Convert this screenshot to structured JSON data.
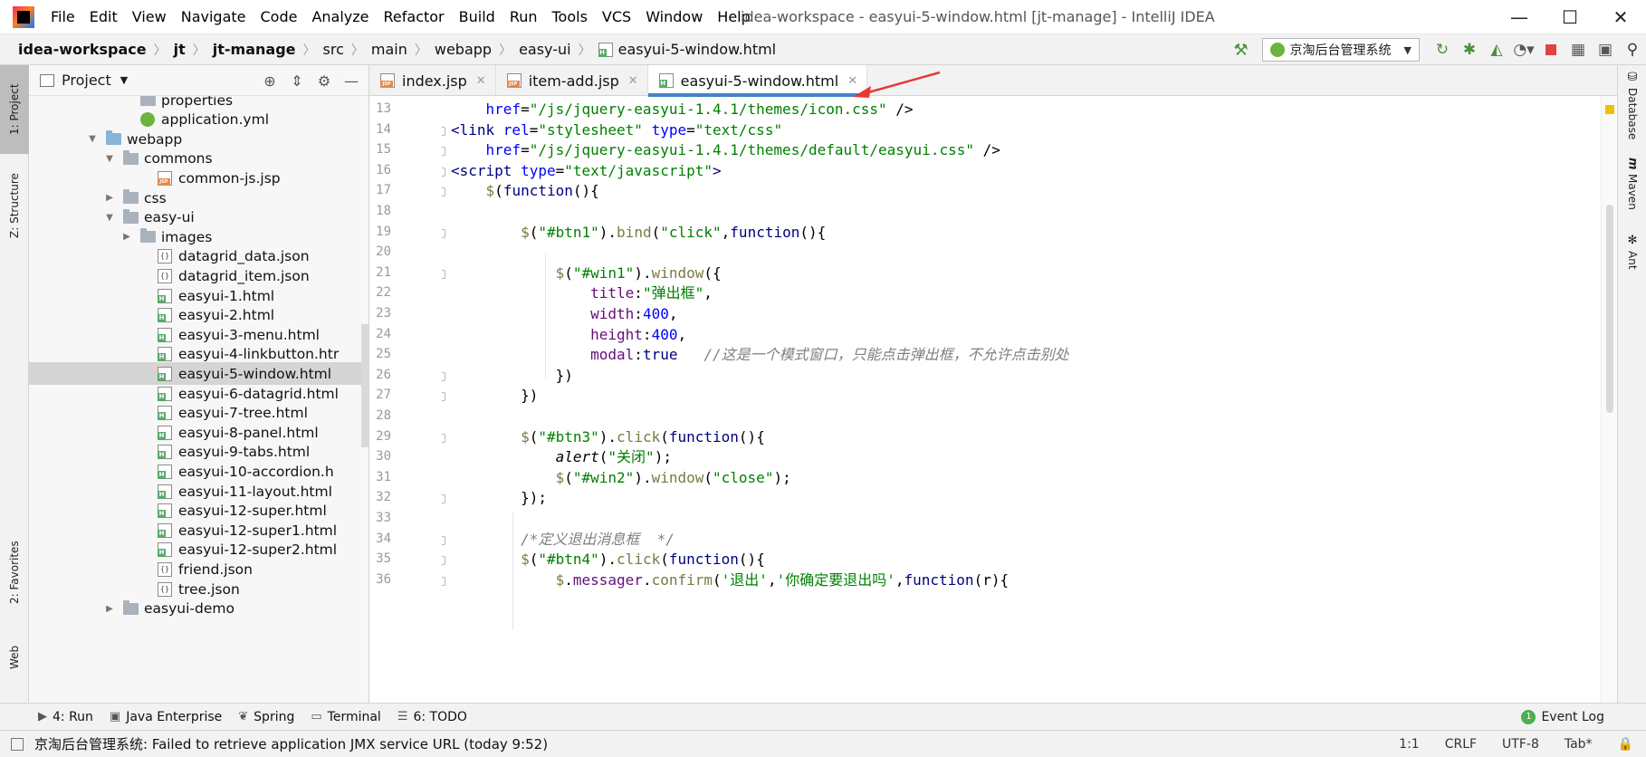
{
  "window": {
    "title": "idea-workspace - easyui-5-window.html [jt-manage] - IntelliJ IDEA",
    "minimize": "—",
    "maximize": "☐",
    "close": "✕"
  },
  "menu": [
    "File",
    "Edit",
    "View",
    "Navigate",
    "Code",
    "Analyze",
    "Refactor",
    "Build",
    "Run",
    "Tools",
    "VCS",
    "Window",
    "Help"
  ],
  "breadcrumb": [
    "idea-workspace",
    "jt",
    "jt-manage",
    "src",
    "main",
    "webapp",
    "easy-ui",
    "easyui-5-window.html"
  ],
  "run_config": {
    "label": "京淘后台管理系统"
  },
  "left_stripe": {
    "project": "1: Project",
    "structure": "Z: Structure",
    "favorites": "2: Favorites",
    "web": "Web"
  },
  "right_stripe": {
    "database": "Database",
    "maven": "Maven",
    "ant": "Ant"
  },
  "project_panel": {
    "title": "Project",
    "tree": [
      {
        "label": "properties",
        "icon": "folder",
        "depth": 7,
        "arrow": ""
      },
      {
        "label": "application.yml",
        "icon": "yml",
        "depth": 7,
        "arrow": ""
      },
      {
        "label": "webapp",
        "icon": "web-folder",
        "depth": 5,
        "arrow": "▼"
      },
      {
        "label": "commons",
        "icon": "folder",
        "depth": 6,
        "arrow": "▼"
      },
      {
        "label": "common-js.jsp",
        "icon": "jsp",
        "depth": 8,
        "arrow": ""
      },
      {
        "label": "css",
        "icon": "folder",
        "depth": 6,
        "arrow": "▶"
      },
      {
        "label": "easy-ui",
        "icon": "folder",
        "depth": 6,
        "arrow": "▼"
      },
      {
        "label": "images",
        "icon": "folder",
        "depth": 7,
        "arrow": "▶"
      },
      {
        "label": "datagrid_data.json",
        "icon": "json",
        "depth": 8,
        "arrow": ""
      },
      {
        "label": "datagrid_item.json",
        "icon": "json",
        "depth": 8,
        "arrow": ""
      },
      {
        "label": "easyui-1.html",
        "icon": "html",
        "depth": 8,
        "arrow": ""
      },
      {
        "label": "easyui-2.html",
        "icon": "html",
        "depth": 8,
        "arrow": ""
      },
      {
        "label": "easyui-3-menu.html",
        "icon": "html",
        "depth": 8,
        "arrow": ""
      },
      {
        "label": "easyui-4-linkbutton.htr",
        "icon": "html",
        "depth": 8,
        "arrow": ""
      },
      {
        "label": "easyui-5-window.html",
        "icon": "html",
        "depth": 8,
        "arrow": "",
        "selected": true
      },
      {
        "label": "easyui-6-datagrid.html",
        "icon": "html",
        "depth": 8,
        "arrow": ""
      },
      {
        "label": "easyui-7-tree.html",
        "icon": "html",
        "depth": 8,
        "arrow": ""
      },
      {
        "label": "easyui-8-panel.html",
        "icon": "html",
        "depth": 8,
        "arrow": ""
      },
      {
        "label": "easyui-9-tabs.html",
        "icon": "html",
        "depth": 8,
        "arrow": ""
      },
      {
        "label": "easyui-10-accordion.h",
        "icon": "html",
        "depth": 8,
        "arrow": ""
      },
      {
        "label": "easyui-11-layout.html",
        "icon": "html",
        "depth": 8,
        "arrow": ""
      },
      {
        "label": "easyui-12-super.html",
        "icon": "html",
        "depth": 8,
        "arrow": ""
      },
      {
        "label": "easyui-12-super1.html",
        "icon": "html",
        "depth": 8,
        "arrow": ""
      },
      {
        "label": "easyui-12-super2.html",
        "icon": "html",
        "depth": 8,
        "arrow": ""
      },
      {
        "label": "friend.json",
        "icon": "json",
        "depth": 8,
        "arrow": ""
      },
      {
        "label": "tree.json",
        "icon": "json",
        "depth": 8,
        "arrow": ""
      },
      {
        "label": "easyui-demo",
        "icon": "folder",
        "depth": 6,
        "arrow": "▶"
      }
    ]
  },
  "tabs": [
    {
      "label": "index.jsp",
      "icon": "jsp",
      "active": false
    },
    {
      "label": "item-add.jsp",
      "icon": "jsp",
      "active": false
    },
    {
      "label": "easyui-5-window.html",
      "icon": "html",
      "active": true
    }
  ],
  "code_lines": [
    {
      "n": "13",
      "fold": false,
      "tokens": [
        [
          "",
          "    "
        ],
        [
          "tok-attr",
          "href"
        ],
        [
          "",
          "="
        ],
        [
          "tok-str",
          "\"/js/jquery-easyui-1.4.1/themes/icon.css\""
        ],
        [
          "",
          " />"
        ]
      ]
    },
    {
      "n": "14",
      "fold": true,
      "tokens": [
        [
          "tok-tag",
          "<link "
        ],
        [
          "tok-attr",
          "rel"
        ],
        [
          "",
          "="
        ],
        [
          "tok-str",
          "\"stylesheet\""
        ],
        [
          "",
          " "
        ],
        [
          "tok-attr",
          "type"
        ],
        [
          "",
          "="
        ],
        [
          "tok-str",
          "\"text/css\""
        ]
      ]
    },
    {
      "n": "15",
      "fold": true,
      "tokens": [
        [
          "",
          "    "
        ],
        [
          "tok-attr",
          "href"
        ],
        [
          "",
          "="
        ],
        [
          "tok-str",
          "\"/js/jquery-easyui-1.4.1/themes/default/easyui.css\""
        ],
        [
          "",
          " />"
        ]
      ]
    },
    {
      "n": "16",
      "fold": true,
      "tokens": [
        [
          "tok-tag",
          "<script "
        ],
        [
          "tok-attr",
          "type"
        ],
        [
          "",
          "="
        ],
        [
          "tok-str",
          "\"text/javascript\""
        ],
        [
          "tok-tag",
          ">"
        ]
      ]
    },
    {
      "n": "17",
      "fold": true,
      "tokens": [
        [
          "",
          "    "
        ],
        [
          "tok-fn",
          "$"
        ],
        [
          "",
          "("
        ],
        [
          "tok-kw",
          "function"
        ],
        [
          "",
          "(){"
        ]
      ]
    },
    {
      "n": "18",
      "fold": false,
      "tokens": []
    },
    {
      "n": "19",
      "fold": true,
      "tokens": [
        [
          "",
          "        "
        ],
        [
          "tok-fn",
          "$"
        ],
        [
          "",
          "("
        ],
        [
          "tok-str",
          "\"#btn1\""
        ],
        [
          "",
          ")."
        ],
        [
          "tok-fn",
          "bind"
        ],
        [
          "",
          "("
        ],
        [
          "tok-str",
          "\"click\""
        ],
        [
          "",
          ","
        ],
        [
          "tok-kw",
          "function"
        ],
        [
          "",
          "(){"
        ]
      ]
    },
    {
      "n": "20",
      "fold": false,
      "tokens": []
    },
    {
      "n": "21",
      "fold": true,
      "tokens": [
        [
          "",
          "            "
        ],
        [
          "tok-fn",
          "$"
        ],
        [
          "",
          "("
        ],
        [
          "tok-str",
          "\"#win1\""
        ],
        [
          "",
          ")."
        ],
        [
          "tok-fn",
          "window"
        ],
        [
          "",
          "({"
        ]
      ]
    },
    {
      "n": "22",
      "fold": false,
      "tokens": [
        [
          "",
          "                "
        ],
        [
          "tok-prop",
          "title"
        ],
        [
          "",
          ":"
        ],
        [
          "tok-str",
          "\"弹出框\""
        ],
        [
          "",
          ","
        ]
      ]
    },
    {
      "n": "23",
      "fold": false,
      "tokens": [
        [
          "",
          "                "
        ],
        [
          "tok-prop",
          "width"
        ],
        [
          "",
          ":"
        ],
        [
          "tok-num",
          "400"
        ],
        [
          "",
          ","
        ]
      ]
    },
    {
      "n": "24",
      "fold": false,
      "tokens": [
        [
          "",
          "                "
        ],
        [
          "tok-prop",
          "height"
        ],
        [
          "",
          ":"
        ],
        [
          "tok-num",
          "400"
        ],
        [
          "",
          ","
        ]
      ]
    },
    {
      "n": "25",
      "fold": false,
      "tokens": [
        [
          "",
          "                "
        ],
        [
          "tok-prop",
          "modal"
        ],
        [
          "",
          ":"
        ],
        [
          "tok-kw",
          "true"
        ],
        [
          "",
          "   "
        ],
        [
          "tok-com",
          "//这是一个模式窗口，只能点击弹出框，不允许点击别处"
        ]
      ]
    },
    {
      "n": "26",
      "fold": true,
      "tokens": [
        [
          "",
          "            })"
        ]
      ]
    },
    {
      "n": "27",
      "fold": true,
      "tokens": [
        [
          "",
          "        })"
        ]
      ]
    },
    {
      "n": "28",
      "fold": false,
      "tokens": []
    },
    {
      "n": "29",
      "fold": true,
      "tokens": [
        [
          "",
          "        "
        ],
        [
          "tok-fn",
          "$"
        ],
        [
          "",
          "("
        ],
        [
          "tok-str",
          "\"#btn3\""
        ],
        [
          "",
          ")."
        ],
        [
          "tok-fn",
          "click"
        ],
        [
          "",
          "("
        ],
        [
          "tok-kw",
          "function"
        ],
        [
          "",
          "(){"
        ]
      ]
    },
    {
      "n": "30",
      "fold": false,
      "tokens": [
        [
          "",
          "            "
        ],
        [
          "tok-ital",
          "alert"
        ],
        [
          "",
          "("
        ],
        [
          "tok-str",
          "\"关闭\""
        ],
        [
          "",
          ");"
        ]
      ]
    },
    {
      "n": "31",
      "fold": false,
      "tokens": [
        [
          "",
          "            "
        ],
        [
          "tok-fn",
          "$"
        ],
        [
          "",
          "("
        ],
        [
          "tok-str",
          "\"#win2\""
        ],
        [
          "",
          ")."
        ],
        [
          "tok-fn",
          "window"
        ],
        [
          "",
          "("
        ],
        [
          "tok-str",
          "\"close\""
        ],
        [
          "",
          ");"
        ]
      ]
    },
    {
      "n": "32",
      "fold": true,
      "tokens": [
        [
          "",
          "        });"
        ]
      ]
    },
    {
      "n": "33",
      "fold": false,
      "tokens": []
    },
    {
      "n": "34",
      "fold": true,
      "tokens": [
        [
          "",
          "        "
        ],
        [
          "tok-com",
          "/*定义退出消息框  */"
        ]
      ]
    },
    {
      "n": "35",
      "fold": true,
      "tokens": [
        [
          "",
          "        "
        ],
        [
          "tok-fn",
          "$"
        ],
        [
          "",
          "("
        ],
        [
          "tok-str",
          "\"#btn4\""
        ],
        [
          "",
          ")."
        ],
        [
          "tok-fn",
          "click"
        ],
        [
          "",
          "("
        ],
        [
          "tok-kw",
          "function"
        ],
        [
          "",
          "(){"
        ]
      ]
    },
    {
      "n": "36",
      "fold": true,
      "tokens": [
        [
          "",
          "            "
        ],
        [
          "tok-fn",
          "$"
        ],
        [
          "",
          "."
        ],
        [
          "tok-prop",
          "messager"
        ],
        [
          "",
          "."
        ],
        [
          "tok-fn",
          "confirm"
        ],
        [
          "",
          "("
        ],
        [
          "tok-str",
          "'退出'"
        ],
        [
          "",
          ","
        ],
        [
          "tok-str",
          "'你确定要退出吗'"
        ],
        [
          "",
          ","
        ],
        [
          "tok-kw",
          "function"
        ],
        [
          "",
          "(r){"
        ]
      ]
    }
  ],
  "bottom_tools": [
    {
      "label": "4: Run",
      "icon": "▶"
    },
    {
      "label": "Java Enterprise",
      "icon": "▣"
    },
    {
      "label": "Spring",
      "icon": "❦"
    },
    {
      "label": "Terminal",
      "icon": "▭"
    },
    {
      "label": "6: TODO",
      "icon": "☰"
    }
  ],
  "event_log": {
    "label": "Event Log",
    "count": "1"
  },
  "status": {
    "message": "京淘后台管理系统: Failed to retrieve application JMX service URL (today 9:52)",
    "position": "1:1",
    "line_sep": "CRLF",
    "encoding": "UTF-8",
    "indent": "Tab*"
  },
  "colors": {
    "accent": "#4083c9",
    "selection": "#d5d5d5"
  }
}
